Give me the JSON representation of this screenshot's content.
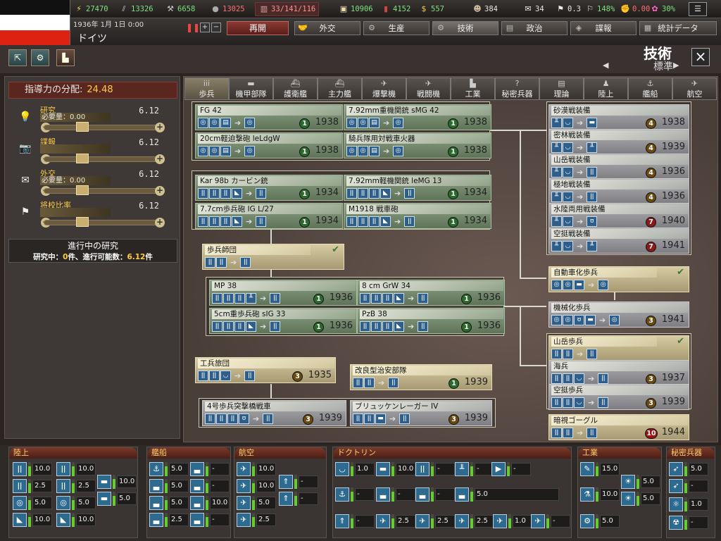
{
  "top": {
    "resources": [
      {
        "icon": "energy-icon",
        "value": "27470",
        "color": "#7fe07f"
      },
      {
        "icon": "metal-icon",
        "value": "13326",
        "color": "#7fe07f"
      },
      {
        "icon": "rare-materials-icon",
        "value": "6658",
        "color": "#7fe07f"
      },
      {
        "icon": "oil-icon",
        "value": "13025",
        "color": "#ff7070"
      },
      {
        "icon": "ic-icon",
        "value": "33/141/116",
        "color": "#ff9090"
      },
      {
        "icon": "supplies-icon",
        "value": "10906",
        "color": "#7fe07f"
      },
      {
        "icon": "fuel-icon",
        "value": "4152",
        "color": "#7fe07f"
      },
      {
        "icon": "money-icon",
        "value": "557",
        "color": "#7fe07f"
      },
      {
        "icon": "manpower-icon",
        "value": "384",
        "color": "#eeeeee"
      },
      {
        "icon": "diplomacy-icon",
        "value": "34",
        "color": "#eeeeee"
      },
      {
        "icon": "dissent-icon",
        "value": "0.3",
        "color": "#eeeeee"
      },
      {
        "icon": "unity-icon",
        "value": "148%",
        "color": "#7fe07f"
      },
      {
        "icon": "neutrality-icon",
        "value": "0.00",
        "color": "#ff7070"
      },
      {
        "icon": "threat-icon",
        "value": "30%",
        "color": "#7fe07f"
      }
    ],
    "date": "1936年 1月 1日 0:00",
    "country": "ドイツ",
    "resume": "再開",
    "nav_tabs": [
      "外交",
      "生産",
      "技術",
      "政治",
      "諜報",
      "統計データ"
    ]
  },
  "title": {
    "main": "技術",
    "sub": "標準"
  },
  "leadership": {
    "label": "指導力の分配:",
    "value": "24.48",
    "rows": [
      {
        "name": "研究",
        "need": "必要量：0.00",
        "value": "6.12",
        "icon": "lightbulb-icon"
      },
      {
        "name": "諜報",
        "need": "",
        "value": "6.12",
        "icon": "camera-icon"
      },
      {
        "name": "外交",
        "need": "必要量：0.00",
        "value": "6.12",
        "icon": "envelope-icon"
      },
      {
        "name": "将校比率",
        "need": "",
        "value": "6.12",
        "icon": "flag-icon"
      }
    ],
    "ongoing_title": "進行中の研究",
    "ongoing_a": "研究中：",
    "ongoing_a_val": "0",
    "ongoing_b": "件、進行可能数：",
    "ongoing_b_val": "6.12",
    "ongoing_c": "件"
  },
  "categories": [
    "歩兵",
    "機甲部隊",
    "護衛艦",
    "主力艦",
    "爆撃機",
    "戦闘機",
    "工業",
    "秘密兵器",
    "理論",
    "陸上",
    "艦船",
    "航空"
  ],
  "techs": {
    "t1": {
      "name": "FG 42",
      "year": "1938",
      "diff": "1"
    },
    "t2": {
      "name": "7.92mm重機関銃 sMG 42",
      "year": "1938",
      "diff": "1"
    },
    "t3": {
      "name": "20cm軽迫撃砲 leLdgW",
      "year": "1938",
      "diff": "1"
    },
    "t4": {
      "name": "騎兵隊用対戦車火器",
      "year": "1938",
      "diff": "1"
    },
    "t5": {
      "name": "Kar 98b カービン銃",
      "year": "1934",
      "diff": "1"
    },
    "t6": {
      "name": "7.92mm軽機関銃 leMG 13",
      "year": "1934",
      "diff": "1"
    },
    "t7": {
      "name": "7.7cm歩兵砲 IG L/27",
      "year": "1934",
      "diff": "1"
    },
    "t8": {
      "name": "M1918 戦車砲",
      "year": "1934",
      "diff": "1"
    },
    "t9": {
      "name": "歩兵師団",
      "year": "",
      "diff": ""
    },
    "t10": {
      "name": "MP 38",
      "year": "1936",
      "diff": "1"
    },
    "t11": {
      "name": "8 cm GrW 34",
      "year": "1936",
      "diff": "1"
    },
    "t12": {
      "name": "5cm重歩兵砲 sIG 33",
      "year": "1936",
      "diff": "1"
    },
    "t13": {
      "name": "PzB 38",
      "year": "1936",
      "diff": "1"
    },
    "t14": {
      "name": "工兵旅団",
      "year": "1935",
      "diff": "3"
    },
    "t15": {
      "name": "改良型治安部隊",
      "year": "1939",
      "diff": "1"
    },
    "t16": {
      "name": "4号歩兵突撃橋戦車",
      "year": "1939",
      "diff": "3"
    },
    "t17": {
      "name": "ブリュッケンレーガー IV",
      "year": "1939",
      "diff": "3"
    },
    "r1": {
      "name": "砂漠戦装備",
      "year": "1938",
      "diff": "4"
    },
    "r2": {
      "name": "密林戦装備",
      "year": "1939",
      "diff": "4"
    },
    "r3": {
      "name": "山岳戦装備",
      "year": "1936",
      "diff": "4"
    },
    "r4": {
      "name": "極地戦装備",
      "year": "1936",
      "diff": "4"
    },
    "r5": {
      "name": "水陸両用戦装備",
      "year": "1940",
      "diff": "7"
    },
    "r6": {
      "name": "空挺戦装備",
      "year": "1941",
      "diff": "7"
    },
    "r7": {
      "name": "自動車化歩兵",
      "year": "",
      "diff": ""
    },
    "r8": {
      "name": "機械化歩兵",
      "year": "1941",
      "diff": "3"
    },
    "r9": {
      "name": "山岳歩兵",
      "year": "",
      "diff": ""
    },
    "r10": {
      "name": "海兵",
      "year": "1937",
      "diff": "3"
    },
    "r11": {
      "name": "空挺歩兵",
      "year": "1939",
      "diff": "3"
    },
    "r12": {
      "name": "暗視ゴーグル",
      "year": "1944",
      "diff": "10"
    }
  },
  "bottom": {
    "land": {
      "title": "陸上",
      "vals": [
        "10.0",
        "10.0",
        "2.5",
        "2.5",
        "5.0",
        "5.0",
        "10.0",
        "10.0",
        "10.0",
        "5.0"
      ]
    },
    "naval": {
      "title": "艦船",
      "vals": [
        "5.0",
        "-",
        "5.0",
        "-",
        "5.0",
        "10.0",
        "2.5",
        "-"
      ]
    },
    "air": {
      "title": "航空",
      "vals": [
        "10.0",
        "10.0",
        "5.0",
        "2.5",
        "-",
        "-"
      ]
    },
    "doctrine": {
      "title": "ドクトリン",
      "vals": [
        "1.0",
        "10.0",
        "-",
        "-",
        "-",
        "-",
        "-",
        "-",
        "5.0",
        "-",
        "2.5",
        "2.5",
        "2.5",
        "1.0",
        "-"
      ]
    },
    "industry": {
      "title": "工業",
      "vals": [
        "15.0",
        "10.0",
        "5.0",
        "5.0",
        "5.0"
      ]
    },
    "secret": {
      "title": "秘密兵器",
      "vals": [
        "5.0",
        "-",
        "1.0",
        "-"
      ]
    }
  }
}
